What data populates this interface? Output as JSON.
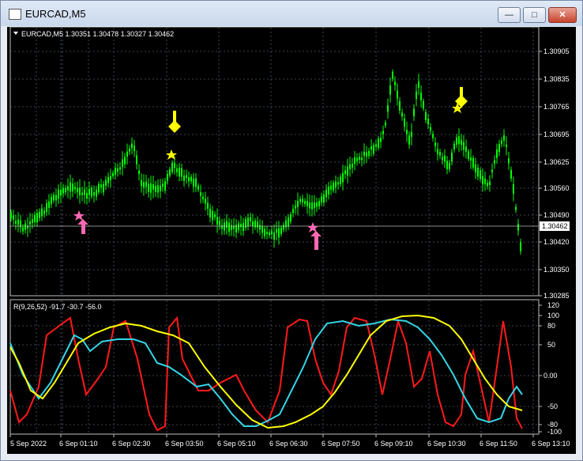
{
  "window": {
    "title": "EURCAD,M5"
  },
  "main_chart": {
    "header": "EURCAD,M5  1.30351 1.30478 1.30327 1.30462",
    "price_ticks": [
      "1.30905",
      "1.30835",
      "1.30765",
      "1.30695",
      "1.30625",
      "1.30560",
      "1.30490",
      "1.30420",
      "1.30350",
      "1.30285"
    ],
    "current_price": "1.30462"
  },
  "indicator": {
    "header": "R(9,26,52) -91.7 -30.7 -56.0",
    "ticks": [
      "120",
      "100",
      "80",
      "50",
      "0.00",
      "-50",
      "-80",
      "-100"
    ]
  },
  "time_axis": [
    "5 Sep 2022",
    "6 Sep 01:10",
    "6 Sep 02:30",
    "6 Sep 03:50",
    "6 Sep 05:10",
    "6 Sep 06:30",
    "6 Sep 07:50",
    "6 Sep 09:10",
    "6 Sep 10:30",
    "6 Sep 11:50",
    "6 Sep 13:10"
  ],
  "colors": {
    "candle": "#00ff00",
    "signal_sell": "#ffff00",
    "signal_buy": "#ff69b4",
    "red_line": "#ff1a1a",
    "cyan_line": "#33d6e6",
    "yellow_line": "#ffff00",
    "grid": "#4a5a6a"
  },
  "icons": {
    "sell_arrow": "arrow-down-icon",
    "buy_arrow": "arrow-up-icon",
    "signal_star": "star-icon"
  }
}
